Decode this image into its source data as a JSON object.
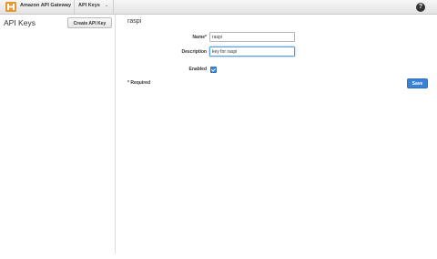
{
  "topbar": {
    "service_name": "Amazon API Gateway",
    "nav_item": "API Keys",
    "nav_caret": "⌄",
    "help_glyph": "?",
    "logo_icon": "api-gateway-logo-icon",
    "logo_color": "#e8962e"
  },
  "sidebar": {
    "title": "API Keys",
    "create_button": "Create API Key"
  },
  "main": {
    "title": "raspi",
    "form": {
      "name_label": "Name*",
      "name_value": "raspi",
      "description_label": "Description",
      "description_value": "key for raspi",
      "enabled_label": "Enabled",
      "enabled_checked": true
    },
    "required_note": "* Required",
    "save_button": "Save"
  },
  "colors": {
    "primary": "#3a82d6",
    "checkbox": "#3b87d6"
  }
}
